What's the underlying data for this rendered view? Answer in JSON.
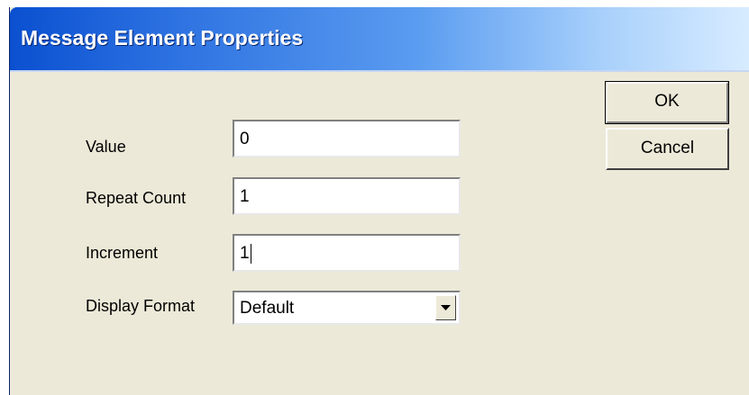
{
  "window": {
    "title": "Message Element Properties"
  },
  "fields": {
    "value": {
      "label": "Value",
      "value": "0"
    },
    "repeat_count": {
      "label": "Repeat Count",
      "value": "1"
    },
    "increment": {
      "label": "Increment",
      "value": "1"
    },
    "display_format": {
      "label": "Display Format",
      "selected": "Default"
    }
  },
  "buttons": {
    "ok": "OK",
    "cancel": "Cancel"
  },
  "icons": {
    "dropdown": "chevron-down-icon"
  },
  "colors": {
    "titlebar_start": "#0a50d0",
    "titlebar_end": "#d8ecff",
    "dialog_background": "#ece9d8"
  }
}
